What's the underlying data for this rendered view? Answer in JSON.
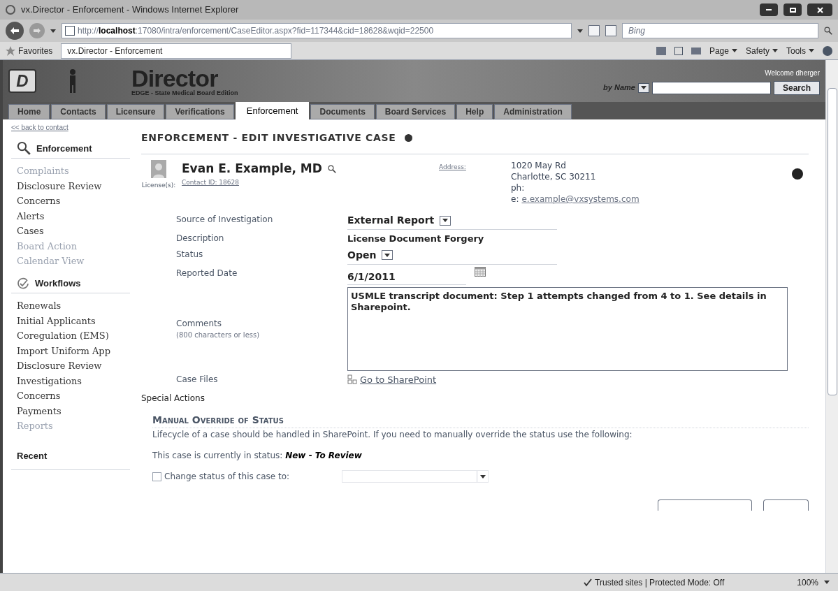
{
  "browser": {
    "title": "vx.Director - Enforcement - Windows Internet Explorer",
    "url_prefix": "http://",
    "url_host": "localhost",
    "url_rest": ":17080/intra/enforcement/CaseEditor.aspx?fid=117344&cid=18628&wqid=22500",
    "search_placeholder": "Bing",
    "favorites": "Favorites",
    "tab_title": "vx.Director - Enforcement",
    "commands": [
      "Page",
      "Safety",
      "Tools"
    ]
  },
  "header": {
    "logo_text": "D",
    "app_name": "Director",
    "edition": "EDGE - State Medical Board Edition",
    "welcome": "Welcome dherger",
    "search_mode": "by Name",
    "search_button": "Search"
  },
  "nav_tabs": [
    {
      "label": "Home",
      "selected": false
    },
    {
      "label": "Contacts",
      "selected": false
    },
    {
      "label": "Licensure",
      "selected": false
    },
    {
      "label": "Verifications",
      "selected": false
    },
    {
      "label": "Enforcement",
      "selected": true
    },
    {
      "label": "Documents",
      "selected": false
    },
    {
      "label": "Board Services",
      "selected": false
    },
    {
      "label": "Help",
      "selected": false
    },
    {
      "label": "Administration",
      "selected": false
    }
  ],
  "back_link": "<< back to contact",
  "sidebar": [
    {
      "title": "Enforcement",
      "kind": "search",
      "items": [
        {
          "label": "Complaints",
          "disabled": true
        },
        {
          "label": "Disclosure Review",
          "disabled": false
        },
        {
          "label": "Concerns",
          "disabled": false
        },
        {
          "label": "Alerts",
          "disabled": false
        },
        {
          "label": "Cases",
          "disabled": false
        },
        {
          "label": "Board Action",
          "disabled": true
        },
        {
          "label": "Calendar View",
          "disabled": true
        }
      ]
    },
    {
      "title": "Workflows",
      "kind": "check",
      "items": [
        {
          "label": "Renewals",
          "disabled": false
        },
        {
          "label": "Initial Applicants",
          "disabled": false
        },
        {
          "label": "Coregulation (EMS)",
          "disabled": false
        },
        {
          "label": "Import Uniform App",
          "disabled": false
        },
        {
          "label": "Disclosure Review",
          "disabled": false
        },
        {
          "label": "Investigations",
          "disabled": false
        },
        {
          "label": "Concerns",
          "disabled": false
        },
        {
          "label": "Payments",
          "disabled": false
        },
        {
          "label": "Reports",
          "disabled": true
        }
      ]
    }
  ],
  "recent": "Recent",
  "page_title": "ENFORCEMENT - EDIT INVESTIGATIVE CASE",
  "contact": {
    "name": "Evan E. Example, MD",
    "contact_id": "Contact ID: 18628",
    "license_label": "License(s):",
    "address_label": "Address:",
    "address_lines": [
      "1020 May Rd",
      "Charlotte, SC 30211",
      "ph:"
    ],
    "email_label": "e:",
    "email": "e.example@vxsystems.com"
  },
  "form": [
    {
      "label": "Source of Investigation",
      "kind": "select",
      "value": "External Report"
    },
    {
      "label": "Description",
      "kind": "text",
      "value": "License Document Forgery"
    },
    {
      "label": "Status",
      "kind": "select",
      "value": "Open"
    },
    {
      "label": "Reported Date",
      "kind": "date",
      "value": "6/1/2011"
    },
    {
      "label": "Comments",
      "hint": "(800 characters or less)",
      "kind": "textarea",
      "value": "USMLE transcript document: Step 1 attempts changed from 4 to 1.  See details in Sharepoint."
    },
    {
      "label": "Case Files",
      "kind": "link",
      "value": "Go to SharePoint"
    }
  ],
  "special": {
    "heading": "Special Actions",
    "subheading": "Manual Override of Status",
    "note": "Lifecycle of a case should be handled in SharePoint. If you need to manually override the status use the following:",
    "status_prefix": "This case is currently in status:",
    "status_value": "New - To Review",
    "change_label": "Change status of this case to:",
    "checked": false
  },
  "status_bar": {
    "zone": "Trusted sites | Protected Mode: Off",
    "zoom": "100%"
  }
}
